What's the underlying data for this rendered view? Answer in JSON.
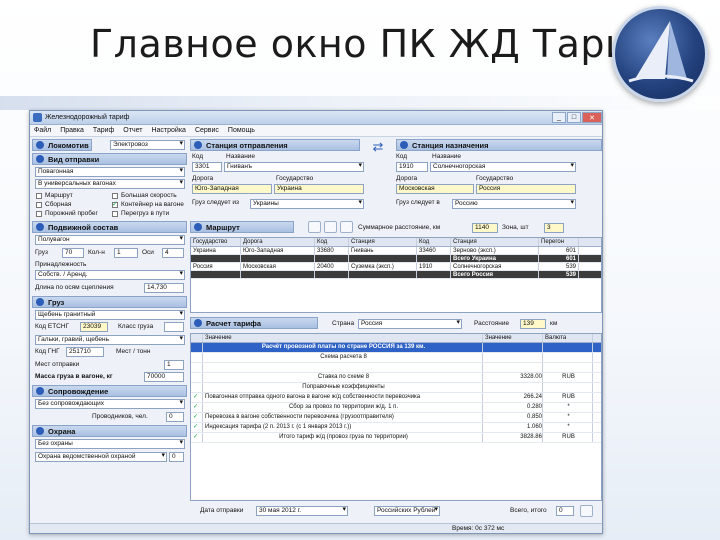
{
  "slide": {
    "title": "Главное окно ПК ЖД Тариф"
  },
  "window": {
    "title": "Железнодорожный тариф",
    "controls": [
      "_",
      "□",
      "✕"
    ]
  },
  "menu": [
    "Файл",
    "Правка",
    "Тариф",
    "Отчет",
    "Настройка",
    "Сервис",
    "Помощь"
  ],
  "left": {
    "locomotive": {
      "label": "Локомотив",
      "value": "Электровоз"
    },
    "shipment": {
      "label": "Вид отправки",
      "value": "Повагонная",
      "value2": "В универсальных вагонах",
      "checks": [
        {
          "label": "Маршрут",
          "on": false
        },
        {
          "label": "Большая скорость",
          "on": false
        },
        {
          "label": "Сборная",
          "on": false
        },
        {
          "label": "Контейнер на вагоне",
          "on": true
        },
        {
          "label": "Порожний пробег",
          "on": false
        },
        {
          "label": "Перегруз в пути",
          "on": false
        }
      ]
    },
    "rolling": {
      "label": "Подвижной состав",
      "value": "Полувагон",
      "gruz_label": "Груз",
      "gruz_value": "70",
      "koln_label": "Кол-н",
      "koln_value": "1",
      "osi_label": "Оси",
      "osi_value": "4",
      "owner_label": "Принадлежность",
      "owner_value": "Собств. / Аренд.",
      "len_label": "Длина по осям сцепления",
      "len_value": "14,730"
    },
    "cargo": {
      "label": "Груз",
      "value": "Щебень гранитный",
      "etsng_label": "Код ЕТСНГ",
      "etsng_value": "23039",
      "class_label": "Класс груза",
      "class_value": "",
      "gng_value": "Гальки, гравий, щебень",
      "gng_code_label": "Код ГНГ",
      "gng_code": "251710",
      "opt_label": "Мест / тонн",
      "places_label": "Мест отправки",
      "places_value": "1",
      "mass_label": "Масса груза в вагоне, кг",
      "mass_value": "70000"
    },
    "escort": {
      "label": "Сопровождение",
      "value": "Без сопровождающих",
      "count_label": "Проводников, чел.",
      "count_value": "0"
    },
    "guard": {
      "label": "Охрана",
      "value": "Без охраны",
      "value2": "Охрана ведомственной охраной",
      "count_value": "0"
    }
  },
  "station_from": {
    "label": "Станция отправления",
    "code_label": "Код",
    "name_label": "Название",
    "code": "3301",
    "name": "Гниванъ",
    "road_label": "Дорога",
    "state_label": "Государство",
    "road": "Юго-Западная",
    "state": "Украина",
    "rule_label": "Груз следует из",
    "rule_value": "Украины"
  },
  "station_to": {
    "label": "Станция назначения",
    "code_label": "Код",
    "name_label": "Название",
    "code": "1910",
    "name": "Солнечногорская",
    "road_label": "Дорога",
    "state_label": "Государство",
    "road": "Московская",
    "state": "Россия",
    "rule_label": "Груз следует в",
    "rule_value": "Россию"
  },
  "route": {
    "label": "Маршрут",
    "distance_label": "Суммарное расстояние, км",
    "distance": "1140",
    "zones_label": "Зона, шт",
    "zones": "3",
    "columns": [
      "Государство",
      "Дорога",
      "Код",
      "Станция",
      "Код",
      "Станция",
      "Перегон"
    ],
    "rows": [
      [
        "Украина",
        "Юго-Западная",
        "33680",
        "Гнивань",
        "33460",
        "Зерново (эксп.)",
        "601"
      ],
      [
        "",
        "",
        "",
        "",
        "",
        "Всего Украина",
        "601"
      ],
      [
        "Россия",
        "Московская",
        "20400",
        "Суземка (эксп.)",
        "1910",
        "Солнечногорская",
        "539"
      ],
      [
        "",
        "",
        "",
        "",
        "",
        "Всего Россия",
        "539"
      ]
    ]
  },
  "tariff": {
    "label": "Расчет тарифа",
    "country_label": "Страна",
    "country": "Россия",
    "dist_label": "Расстояние",
    "dist": "139",
    "dist_unit": "км",
    "columns": [
      "Значение",
      "Значение",
      "Валюта"
    ],
    "rows": [
      [
        "Расчёт провозной платы по стране РОССИЯ за 139 км.",
        "",
        ""
      ],
      [
        "Схема расчета 8",
        "",
        ""
      ],
      [
        "",
        "",
        ""
      ],
      [
        "Ставка по схеме 8",
        "3328.00",
        "RUB"
      ],
      [
        "Поправочные коэффициенты",
        "",
        ""
      ],
      [
        "Повагонная отправка одного вагона в вагоне ж/д собственности перевозчика",
        "266.24",
        "RUB"
      ],
      [
        "Сбор за провоз по территории ж/д. 1 п.",
        "0.280",
        "*"
      ],
      [
        "Перевозка в вагоне собственности перевозчика (грузоотправителя)",
        "0.850",
        "*"
      ],
      [
        "Индексация тарифа (2 п. 2013 г. (с 1 января 2013 г.))",
        "1.060",
        "*"
      ],
      [
        "Итого тариф ж/д (провоз груза по территории)",
        "3828.86",
        "RUB"
      ]
    ]
  },
  "bottom": {
    "date_label": "Дата отправки",
    "date": "30 мая 2012 г.",
    "currency": "Российских Рублей",
    "calc_label": "Всего, итого",
    "calc_value": "0"
  },
  "status": {
    "time": "Время: 0с 372 мс"
  }
}
